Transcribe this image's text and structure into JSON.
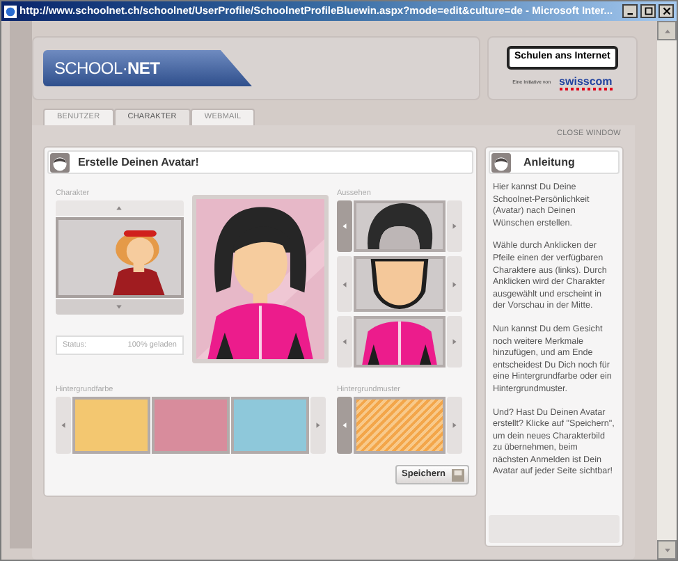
{
  "window": {
    "title": "http://www.schoolnet.ch/schoolnet/UserProfile/SchoolnetProfileBluewin.aspx?mode=edit&culture=de - Microsoft Inter..."
  },
  "header": {
    "logo": "SCHOOL·**NET**",
    "sponsor_button": "Schulen ans Internet",
    "initiative": "Eine Initiative von",
    "sponsor_logo": "swisscom"
  },
  "tabs": [
    {
      "label": "BENUTZER",
      "selected": false
    },
    {
      "label": "CHARAKTER",
      "selected": true
    },
    {
      "label": "WEBMAIL",
      "selected": false
    }
  ],
  "close_link": "CLOSE WINDOW",
  "avatar_panel": {
    "title": "Erstelle Deinen Avatar!",
    "character_label": "Charakter",
    "status_label": "Status:",
    "status_value": "100% geladen",
    "appearance_label": "Aussehen",
    "background_color_label": "Hintergrundfarbe",
    "swatches": [
      {
        "color": "#f3c770"
      },
      {
        "color": "#d88c9c"
      },
      {
        "color": "#8ec8da"
      }
    ],
    "background_pattern_label": "Hintergrundmuster",
    "save_button": "Speichern"
  },
  "instructions": {
    "title": "Anleitung",
    "paragraphs": [
      "Hier kannst Du Deine Schoolnet-Persönlichkeit (Avatar) nach Deinen Wünschen erstellen.",
      "Wähle durch Anklicken der Pfeile einen der verfügbaren Charaktere aus (links). Durch Anklicken wird der Charakter ausgewählt und erscheint in der Vorschau in der Mitte.",
      "Nun kannst Du dem Gesicht noch weitere Merkmale hinzufügen, und am Ende entscheidest Du Dich noch für eine Hintergrundfarbe oder ein Hintergrundmuster.",
      "Und? Hast Du Deinen Avatar erstellt? Klicke auf \"Speichern\", um dein neues Charakterbild zu übernehmen, beim nächsten Anmelden ist Dein Avatar auf jeder Seite sichtbar!"
    ]
  }
}
